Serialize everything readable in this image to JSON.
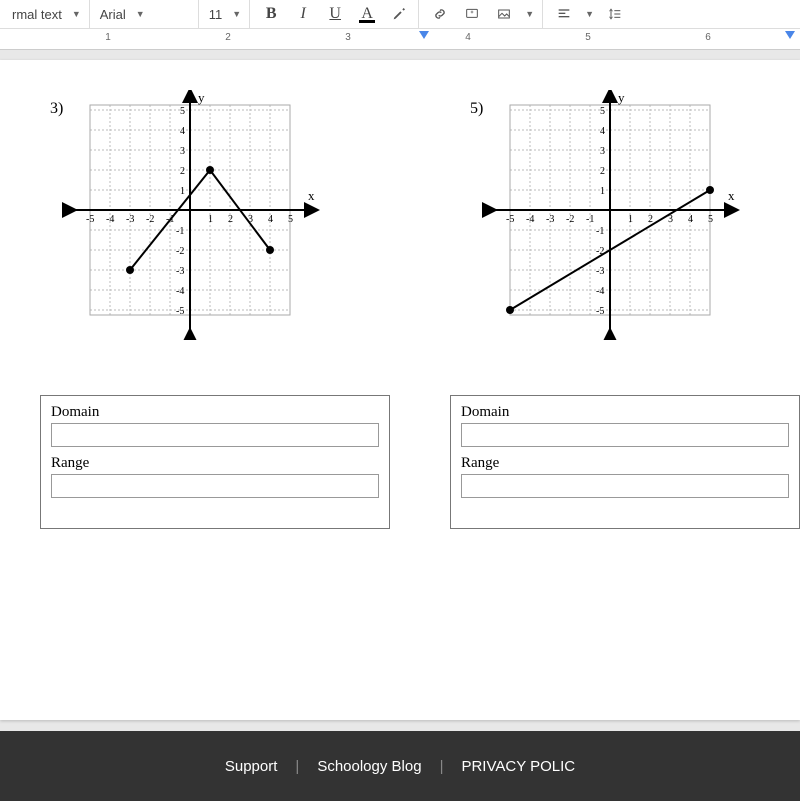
{
  "toolbar": {
    "style_label": "rmal text",
    "font_label": "Arial",
    "size_label": "11",
    "bold": "B",
    "italic": "I",
    "underline": "U",
    "textcolor": "A"
  },
  "ruler": {
    "numbers": [
      "1",
      "2",
      "3",
      "4",
      "5",
      "6"
    ]
  },
  "graphs": {
    "left": {
      "number": "3)",
      "ylabel": "y",
      "xlabel": "x"
    },
    "right": {
      "number": "5)",
      "ylabel": "y",
      "xlabel": "x"
    }
  },
  "tables": {
    "domain_label": "Domain",
    "range_label": "Range"
  },
  "footer": {
    "support": "Support",
    "blog": "Schoology Blog",
    "privacy": "PRIVACY POLIC"
  },
  "chart_data": [
    {
      "id": "3",
      "type": "line",
      "xlim": [
        -5,
        5
      ],
      "ylim": [
        -5,
        5
      ],
      "xlabel": "x",
      "ylabel": "y",
      "series": [
        {
          "name": "piecewise",
          "points": [
            [
              -3,
              -3
            ],
            [
              1,
              2
            ],
            [
              4,
              -2
            ]
          ]
        }
      ]
    },
    {
      "id": "5",
      "type": "line",
      "xlim": [
        -5,
        5
      ],
      "ylim": [
        -5,
        5
      ],
      "xlabel": "x",
      "ylabel": "y",
      "series": [
        {
          "name": "line",
          "points": [
            [
              -5,
              -5
            ],
            [
              5,
              1
            ]
          ]
        }
      ]
    }
  ]
}
